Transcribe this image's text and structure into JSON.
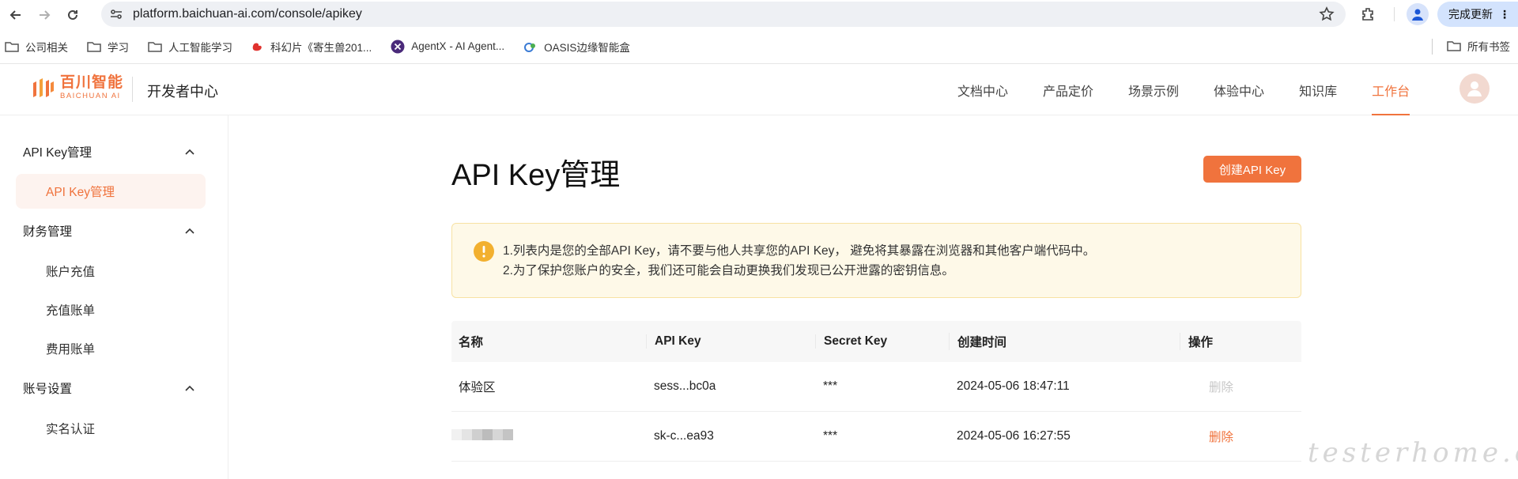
{
  "browser": {
    "url": "platform.baichuan-ai.com/console/apikey",
    "update_label": "完成更新",
    "bookmarks": [
      "公司相关",
      "学习",
      "人工智能学习",
      "科幻片《寄生兽201...",
      "AgentX - AI Agent...",
      "OASIS边缘智能盒"
    ],
    "all_bookmarks": "所有书签"
  },
  "header": {
    "logo_cn": "百川智能",
    "logo_en": "BAICHUAN AI",
    "dev_center": "开发者中心",
    "nav": [
      "文档中心",
      "产品定价",
      "场景示例",
      "体验中心",
      "知识库",
      "工作台"
    ],
    "active_nav": "工作台"
  },
  "sidebar": {
    "groups": [
      {
        "label": "API Key管理",
        "items": [
          "API Key管理"
        ]
      },
      {
        "label": "财务管理",
        "items": [
          "账户充值",
          "充值账单",
          "费用账单"
        ]
      },
      {
        "label": "账号设置",
        "items": [
          "实名认证"
        ]
      }
    ]
  },
  "main": {
    "title": "API Key管理",
    "create_label": "创建API Key",
    "notice_line1": "1.列表内是您的全部API Key，请不要与他人共享您的API Key， 避免将其暴露在浏览器和其他客户端代码中。",
    "notice_line2": "2.为了保护您账户的安全，我们还可能会自动更换我们发现已公开泄露的密钥信息。",
    "table": {
      "headers": [
        "名称",
        "API Key",
        "Secret Key",
        "创建时间",
        "操作"
      ],
      "rows": [
        {
          "name": "体验区",
          "api_key": "sess...bc0a",
          "secret": "***",
          "created": "2024-05-06 18:47:11",
          "action": "删除"
        },
        {
          "name": "",
          "api_key": "sk-c...ea93",
          "secret": "***",
          "created": "2024-05-06 16:27:55",
          "action": "删除"
        }
      ]
    }
  },
  "watermark": "testerhome.com",
  "colors": {
    "accent": "#f0733d",
    "notice_bg": "#fef9e8",
    "warn": "#f2b02f"
  }
}
